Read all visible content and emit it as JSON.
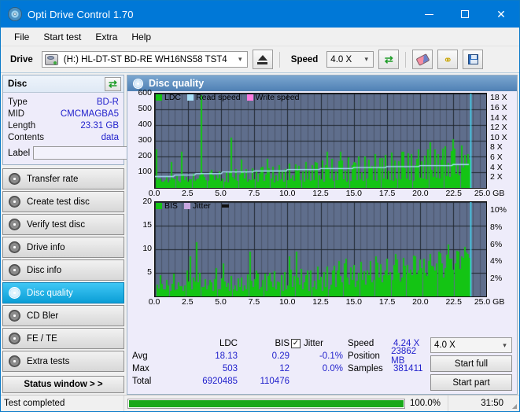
{
  "window": {
    "title": "Opti Drive Control 1.70",
    "icon": "disc-icon",
    "minimize": "minimize",
    "maximize": "maximize",
    "close": "close"
  },
  "menu": [
    "File",
    "Start test",
    "Extra",
    "Help"
  ],
  "toolbar": {
    "drive_label": "Drive",
    "drive_value": "(H:)  HL-DT-ST BD-RE  WH16NS58 TST4",
    "eject": "eject-icon",
    "speed_label": "Speed",
    "speed_value": "4.0 X",
    "refresh": "refresh-icon",
    "erase": "eraser-icon",
    "keys": "keys-icon",
    "save": "save-icon"
  },
  "disc": {
    "title": "Disc",
    "refresh": "refresh-icon",
    "rows": [
      {
        "key": "Type",
        "value": "BD-R"
      },
      {
        "key": "MID",
        "value": "CMCMAGBA5"
      },
      {
        "key": "Length",
        "value": "23.31 GB"
      },
      {
        "key": "Contents",
        "value": "data"
      }
    ],
    "label_key": "Label",
    "label_value": "",
    "label_placeholder": "",
    "label_button": "disc-label-icon"
  },
  "nav": [
    {
      "label": "Transfer rate",
      "active": false
    },
    {
      "label": "Create test disc",
      "active": false
    },
    {
      "label": "Verify test disc",
      "active": false
    },
    {
      "label": "Drive info",
      "active": false
    },
    {
      "label": "Disc info",
      "active": false
    },
    {
      "label": "Disc quality",
      "active": true
    },
    {
      "label": "CD Bler",
      "active": false
    },
    {
      "label": "FE / TE",
      "active": false
    },
    {
      "label": "Extra tests",
      "active": false
    }
  ],
  "status_window_button": "Status window > >",
  "main": {
    "title": "Disc quality"
  },
  "stats": {
    "headers": [
      "",
      "LDC",
      "BIS"
    ],
    "rows": [
      {
        "label": "Avg",
        "ldc": "18.13",
        "bis": "0.29"
      },
      {
        "label": "Max",
        "ldc": "503",
        "bis": "12"
      },
      {
        "label": "Total",
        "ldc": "6920485",
        "bis": "110476"
      }
    ],
    "jitter_checked": true,
    "jitter_label": "Jitter",
    "jitter_values": [
      "-0.1%",
      "0.0%"
    ],
    "speed_label": "Speed",
    "speed_value": "4.24 X",
    "position_label": "Position",
    "position_value": "23862 MB",
    "samples_label": "Samples",
    "samples_value": "381411",
    "speed_select": "4.0 X",
    "start_full": "Start full",
    "start_part": "Start part"
  },
  "statusbar": {
    "message": "Test completed",
    "percent_text": "100.0%",
    "progress": 100,
    "time": "31:50"
  },
  "colors": {
    "accent": "#0078d7",
    "ldc": "#14c414",
    "bis": "#14c414",
    "read_speed": "#a8e0f8",
    "write_speed": "#ff7ae0",
    "jitter": "#c9a8e0",
    "plot_bg": "#5f6e8c",
    "grid": "#3c4658",
    "progress": "#18a818",
    "value_text": "#2222cc"
  },
  "chart_data": [
    {
      "type": "bar",
      "title": "LDC",
      "xlabel": "GB",
      "ylabel": "LDC",
      "legend": [
        {
          "label": "LDC",
          "color": "#14c414"
        },
        {
          "label": "Read speed",
          "color": "#a8e0f8"
        },
        {
          "label": "Write speed",
          "color": "#ff7ae0"
        }
      ],
      "legend_position": "top-left",
      "grid": true,
      "xlim": [
        0.0,
        25.0
      ],
      "xticks": [
        "0.0",
        "2.5",
        "5.0",
        "7.5",
        "10.0",
        "12.5",
        "15.0",
        "17.5",
        "20.0",
        "22.5",
        "25.0 GB"
      ],
      "ylim": [
        0,
        600
      ],
      "yticks": [
        100,
        200,
        300,
        400,
        500,
        600
      ],
      "y2label": "Speed",
      "y2lim": [
        0,
        19
      ],
      "y2ticks": [
        "2 X",
        "4 X",
        "6 X",
        "8 X",
        "10 X",
        "12 X",
        "14 X",
        "16 X",
        "18 X"
      ],
      "series": [
        {
          "name": "LDC",
          "type": "bar",
          "color": "#14c414",
          "x": [
            0.05,
            0.25,
            0.45,
            0.7,
            0.95,
            1.2,
            1.45,
            1.7,
            1.95,
            2.2,
            2.45,
            2.7,
            2.95,
            3.2,
            3.45,
            3.7,
            3.95,
            4.2,
            4.45,
            4.7,
            4.95,
            5.2,
            5.45,
            5.7,
            5.95,
            6.2,
            6.45,
            6.7,
            6.95,
            7.2,
            7.45,
            7.7,
            7.95,
            8.2,
            8.45,
            8.7,
            8.95,
            9.2,
            9.45,
            9.7,
            9.95,
            10.2,
            10.45,
            10.7,
            10.95,
            11.2,
            11.45,
            11.7,
            11.95,
            12.2,
            12.45,
            12.7,
            12.95,
            13.2,
            13.45,
            13.7,
            13.95,
            14.2,
            14.45,
            14.7,
            14.95,
            15.2,
            15.45,
            15.7,
            15.95,
            16.2,
            16.45,
            16.7,
            16.95,
            17.2,
            17.45,
            17.7,
            17.95,
            18.2,
            18.45,
            18.7,
            18.95,
            19.2,
            19.45,
            19.7,
            19.95,
            20.2,
            20.45,
            20.7,
            20.95,
            21.2,
            21.45,
            21.7,
            21.95,
            22.2,
            22.45,
            22.7,
            22.95,
            23.2,
            23.45,
            23.7
          ],
          "values": [
            245,
            60,
            40,
            50,
            35,
            165,
            55,
            45,
            230,
            50,
            40,
            55,
            45,
            60,
            590,
            70,
            45,
            115,
            50,
            60,
            45,
            40,
            35,
            320,
            55,
            45,
            180,
            60,
            40,
            50,
            55,
            40,
            130,
            45,
            185,
            60,
            35,
            45,
            55,
            40,
            50,
            60,
            45,
            110,
            50,
            40,
            55,
            45,
            50,
            160,
            55,
            40,
            230,
            60,
            45,
            50,
            230,
            55,
            40,
            45,
            165,
            50,
            55,
            45,
            60,
            125,
            50,
            45,
            190,
            60,
            55,
            50,
            45,
            60,
            55,
            230,
            60,
            50,
            45,
            185,
            65,
            60,
            55,
            290,
            70,
            65,
            60,
            250,
            75,
            70,
            310,
            90,
            80,
            130,
            150,
            180
          ]
        },
        {
          "name": "Read speed",
          "type": "line",
          "color": "#a8e0f8",
          "axis": "y2",
          "x": [
            0.0,
            1.4,
            1.5,
            3.0,
            3.1,
            5.0,
            5.1,
            7.4,
            7.5,
            9.9,
            10.0,
            12.4,
            12.5,
            14.9,
            15.0,
            17.4,
            17.5,
            19.9,
            20.0,
            22.4,
            22.5,
            23.7
          ],
          "values": [
            2.3,
            2.3,
            2.6,
            2.6,
            2.9,
            2.9,
            3.2,
            3.2,
            3.4,
            3.4,
            3.7,
            3.7,
            3.9,
            3.9,
            4.1,
            4.1,
            4.3,
            4.3,
            4.5,
            4.5,
            4.7,
            4.7
          ]
        },
        {
          "name": "End marker",
          "type": "vline",
          "color": "#45d6f2",
          "x": 23.8
        }
      ]
    },
    {
      "type": "bar",
      "title": "BIS",
      "xlabel": "GB",
      "ylabel": "BIS",
      "legend": [
        {
          "label": "BIS",
          "color": "#14c414"
        },
        {
          "label": "Jitter",
          "color": "#c9a8e0"
        }
      ],
      "legend_position": "top-left",
      "grid": true,
      "xlim": [
        0.0,
        25.0
      ],
      "xticks": [
        "0.0",
        "2.5",
        "5.0",
        "7.5",
        "10.0",
        "12.5",
        "15.0",
        "17.5",
        "20.0",
        "22.5",
        "25.0 GB"
      ],
      "ylim": [
        0,
        20
      ],
      "yticks": [
        5,
        10,
        15,
        20
      ],
      "y2label": "Jitter",
      "y2lim": [
        0,
        11
      ],
      "y2ticks": [
        "2%",
        "4%",
        "6%",
        "8%",
        "10%"
      ],
      "series": [
        {
          "name": "BIS",
          "type": "bar",
          "color": "#14c414",
          "x": [
            0.1,
            0.35,
            0.6,
            0.85,
            1.1,
            1.35,
            1.6,
            1.85,
            2.1,
            2.35,
            2.6,
            2.85,
            3.1,
            3.35,
            3.6,
            3.85,
            4.1,
            4.35,
            4.6,
            4.85,
            5.1,
            5.35,
            5.6,
            5.85,
            6.1,
            6.35,
            6.6,
            6.85,
            7.1,
            7.35,
            7.6,
            7.85,
            8.1,
            8.35,
            8.6,
            8.85,
            9.1,
            9.35,
            9.6,
            9.85,
            10.1,
            10.35,
            10.6,
            10.85,
            11.1,
            11.35,
            11.6,
            11.85,
            12.1,
            12.35,
            12.6,
            12.85,
            13.1,
            13.35,
            13.6,
            13.85,
            14.1,
            14.35,
            14.6,
            14.85,
            15.1,
            15.35,
            15.6,
            15.85,
            16.1,
            16.35,
            16.6,
            16.85,
            17.1,
            17.35,
            17.6,
            17.85,
            18.1,
            18.35,
            18.6,
            18.85,
            19.1,
            19.35,
            19.6,
            19.85,
            20.1,
            20.35,
            20.6,
            20.85,
            21.1,
            21.35,
            21.6,
            21.85,
            22.1,
            22.35,
            22.6,
            22.85,
            23.1,
            23.35,
            23.6,
            23.75
          ],
          "values": [
            2.5,
            4.5,
            1.5,
            3.5,
            1.2,
            4.8,
            1.5,
            2.2,
            1.2,
            5.5,
            8.5,
            4.0,
            11.5,
            5.0,
            2.0,
            1.5,
            3.5,
            1.2,
            6.0,
            1.5,
            7.0,
            2.0,
            1.2,
            1.5,
            1.2,
            2.0,
            1.2,
            1.5,
            9.5,
            2.0,
            5.5,
            1.5,
            3.5,
            1.2,
            5.0,
            2.0,
            1.5,
            3.0,
            1.2,
            1.5,
            8.5,
            2.0,
            9.5,
            2.5,
            1.5,
            4.5,
            1.2,
            2.0,
            1.5,
            3.5,
            1.2,
            2.0,
            1.5,
            5.5,
            2.0,
            7.5,
            3.0,
            8.0,
            2.5,
            3.5,
            2.0,
            5.0,
            3.5,
            2.5,
            4.5,
            3.0,
            8.5,
            4.0,
            3.0,
            5.5,
            4.5,
            3.5,
            9.0,
            5.0,
            4.0,
            6.5,
            5.0,
            4.5,
            8.5,
            5.5,
            6.0,
            5.0,
            7.5,
            6.5,
            5.5,
            9.5,
            7.0,
            6.0,
            11.0,
            8.0,
            7.0,
            9.5,
            8.5,
            10.5,
            9.0,
            7.5
          ]
        },
        {
          "name": "End marker",
          "type": "vline",
          "color": "#45d6f2",
          "x": 23.8
        }
      ]
    }
  ]
}
